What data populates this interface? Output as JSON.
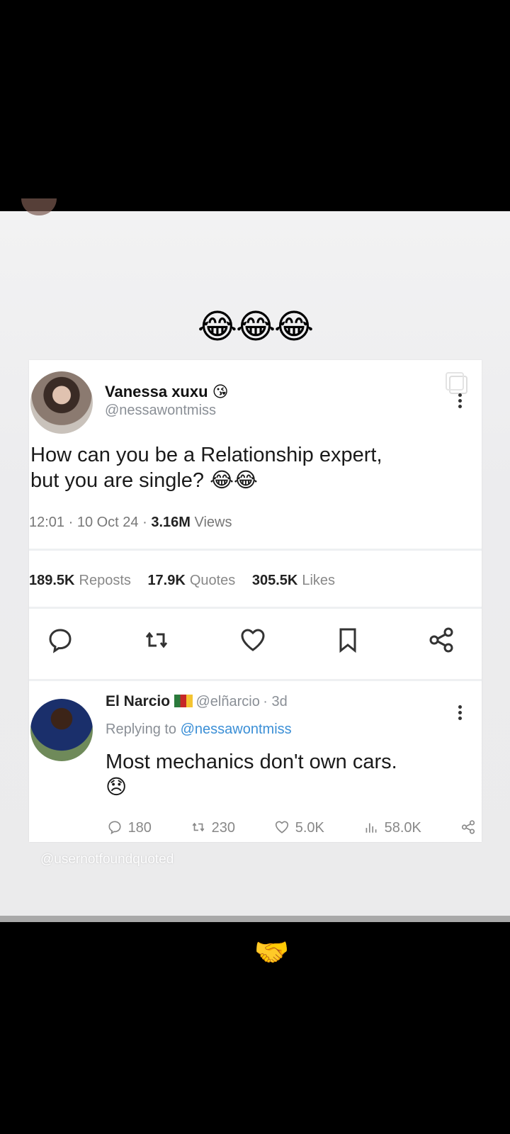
{
  "caption_top": "😂😂😂",
  "tweet": {
    "name": "Vanessa xuxu 😘",
    "handle": "@nessawontmiss",
    "text_line1": "How can you be a Relationship expert,",
    "text_line2": "but you are single? 😂😂",
    "time": "12:01 · 10 Oct 24 · ",
    "views_count": "3.16M",
    "views_label": "Views",
    "reposts": "189.5K",
    "reposts_label": "Reposts",
    "quotes": "17.9K",
    "quotes_label": "Quotes",
    "likes": "305.5K",
    "likes_label": "Likes"
  },
  "reply": {
    "name": "El Narcio",
    "handle": "@elñarcio",
    "time": "· 3d",
    "replying_to_label": "Replying to",
    "replying_to_handle": "@nessawontmiss",
    "text": "Most mechanics don't own cars.",
    "emoji": "😞",
    "replies": "180",
    "reposts": "230",
    "likes": "5.0K",
    "views": "58.0K"
  },
  "watermark": "@usernotfoundquoted",
  "caption_bottom": "😂🤝",
  "icons": [
    "reply-icon",
    "repost-icon",
    "like-icon",
    "bookmark-icon",
    "share-icon",
    "more-icon",
    "copy-icon"
  ]
}
